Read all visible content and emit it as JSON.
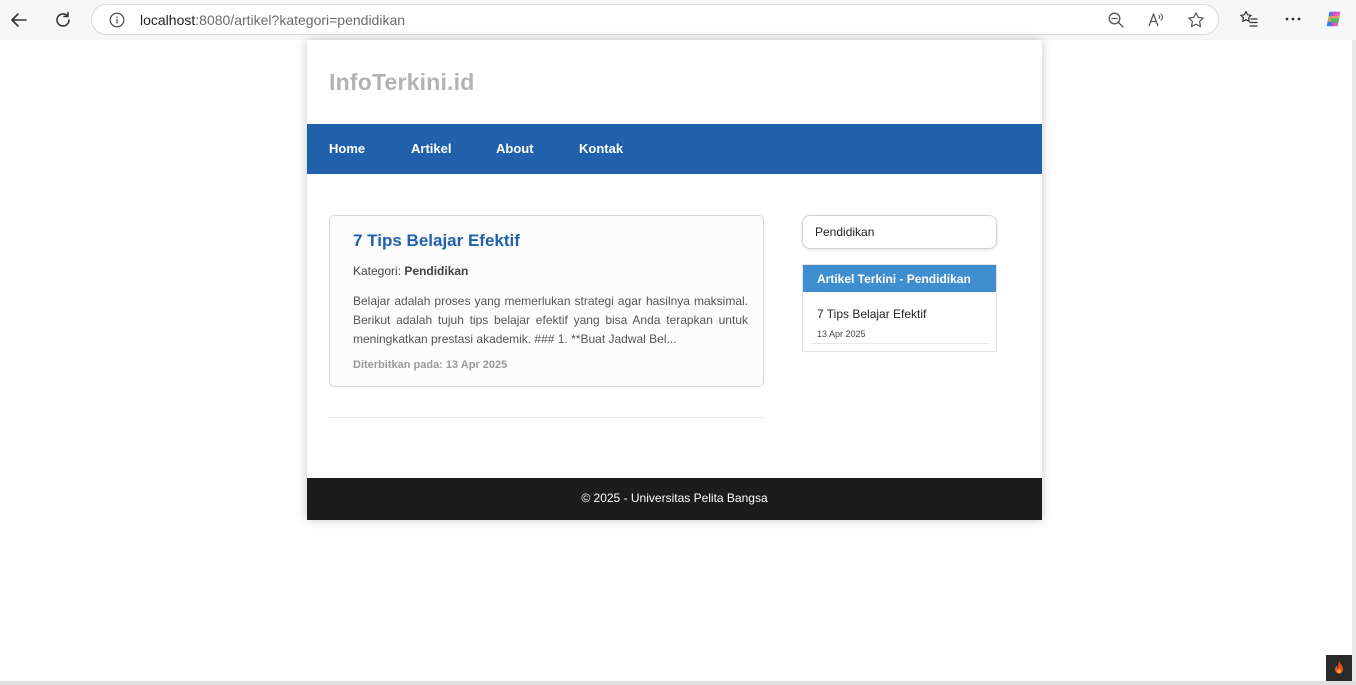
{
  "browser": {
    "url_host": "localhost",
    "url_rest": ":8080/artikel?kategori=pendidikan"
  },
  "site": {
    "title": "InfoTerkini.id"
  },
  "nav": {
    "items": [
      "Home",
      "Artikel",
      "About",
      "Kontak"
    ]
  },
  "article": {
    "title": "7 Tips Belajar Efektif",
    "category_label": "Kategori:",
    "category": "Pendidikan",
    "excerpt": "Belajar adalah proses yang memerlukan strategi agar hasilnya maksimal. Berikut adalah tujuh tips belajar efektif yang bisa Anda terapkan untuk meningkatkan prestasi akademik. ### 1. **Buat Jadwal Bel...",
    "published": "Diterbitkan pada: 13 Apr 2025"
  },
  "sidebar": {
    "category_select": "Pendidikan",
    "widget_title": "Artikel Terkini - Pendidikan",
    "items": [
      {
        "title": "7 Tips Belajar Efektif",
        "date": "13 Apr 2025"
      }
    ]
  },
  "footer": {
    "text": "© 2025 - Universitas Pelita Bangsa"
  },
  "colors": {
    "nav_bg": "#2161ab",
    "widget_header_bg": "#3f8ed0",
    "footer_bg": "#1c1c1c",
    "title_gray": "#b3b3b3"
  }
}
